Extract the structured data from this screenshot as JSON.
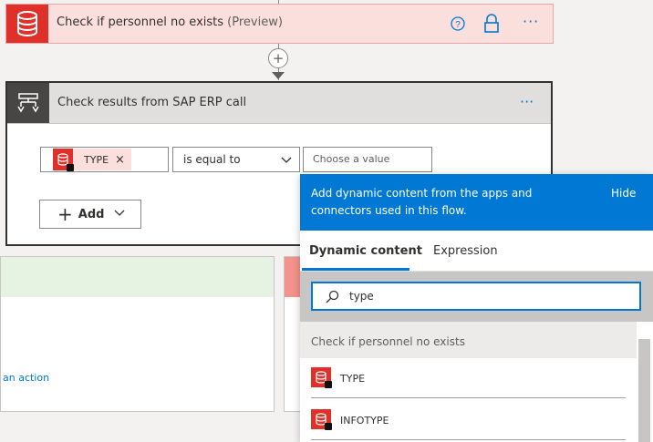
{
  "step1": {
    "title": "Check if personnel no exists",
    "preview": "(Preview)",
    "help_icon": "help-circle-icon",
    "lock_icon": "lock-icon",
    "more": "···",
    "icon": "database-icon",
    "colors": {
      "accent": "#e0302a",
      "bg": "#fadfdc"
    }
  },
  "connector": {
    "plus": "+"
  },
  "condition": {
    "title": "Check results from SAP ERP call",
    "more": "···",
    "icon": "condition-icon",
    "left_token": {
      "label": "TYPE",
      "close": "×"
    },
    "operator": "is equal to",
    "value_placeholder": "Choose a value",
    "add_label": "Add",
    "add_plus": "+"
  },
  "branches": {
    "yes_link": "an action"
  },
  "panel": {
    "message": "Add dynamic content from the apps and connectors used in this flow.",
    "hide": "Hide",
    "tabs": [
      {
        "label": "Dynamic content",
        "active": true
      },
      {
        "label": "Expression",
        "active": false
      }
    ],
    "search_value": "type",
    "section": "Check if personnel no exists",
    "items": [
      {
        "label": "TYPE"
      },
      {
        "label": "INFOTYPE"
      }
    ],
    "colors": {
      "accent": "#0078d4"
    }
  }
}
